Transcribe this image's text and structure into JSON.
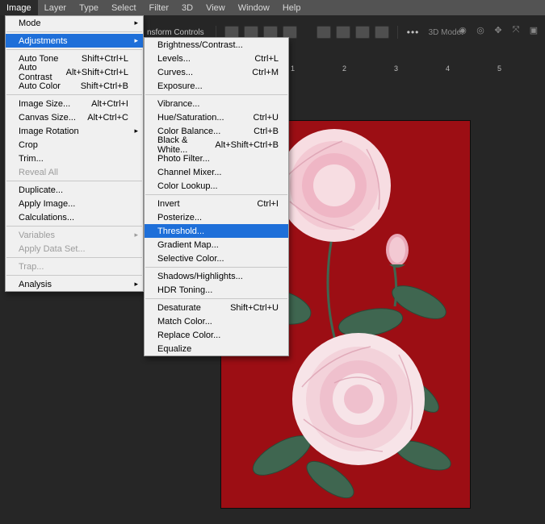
{
  "menubar": [
    "Image",
    "Layer",
    "Type",
    "Select",
    "Filter",
    "3D",
    "View",
    "Window",
    "Help"
  ],
  "menubar_active_index": 0,
  "options_label": "nsform Controls",
  "options_3dmode": "3D Mode:",
  "image_menu": [
    {
      "label": "Mode",
      "submenu": true,
      "shortcut": ""
    },
    {
      "sep": true
    },
    {
      "label": "Adjustments",
      "submenu": true,
      "highlight": true,
      "shortcut": ""
    },
    {
      "sep": true
    },
    {
      "label": "Auto Tone",
      "shortcut": "Shift+Ctrl+L"
    },
    {
      "label": "Auto Contrast",
      "shortcut": "Alt+Shift+Ctrl+L"
    },
    {
      "label": "Auto Color",
      "shortcut": "Shift+Ctrl+B"
    },
    {
      "sep": true
    },
    {
      "label": "Image Size...",
      "shortcut": "Alt+Ctrl+I"
    },
    {
      "label": "Canvas Size...",
      "shortcut": "Alt+Ctrl+C"
    },
    {
      "label": "Image Rotation",
      "submenu": true,
      "shortcut": ""
    },
    {
      "label": "Crop",
      "shortcut": ""
    },
    {
      "label": "Trim...",
      "shortcut": ""
    },
    {
      "label": "Reveal All",
      "shortcut": "",
      "disabled": true
    },
    {
      "sep": true
    },
    {
      "label": "Duplicate...",
      "shortcut": ""
    },
    {
      "label": "Apply Image...",
      "shortcut": ""
    },
    {
      "label": "Calculations...",
      "shortcut": ""
    },
    {
      "sep": true
    },
    {
      "label": "Variables",
      "submenu": true,
      "disabled": true,
      "shortcut": ""
    },
    {
      "label": "Apply Data Set...",
      "disabled": true,
      "shortcut": ""
    },
    {
      "sep": true
    },
    {
      "label": "Trap...",
      "disabled": true,
      "shortcut": ""
    },
    {
      "sep": true
    },
    {
      "label": "Analysis",
      "submenu": true,
      "shortcut": ""
    }
  ],
  "adjustments_menu": [
    {
      "label": "Brightness/Contrast...",
      "shortcut": ""
    },
    {
      "label": "Levels...",
      "shortcut": "Ctrl+L"
    },
    {
      "label": "Curves...",
      "shortcut": "Ctrl+M"
    },
    {
      "label": "Exposure...",
      "shortcut": ""
    },
    {
      "sep": true
    },
    {
      "label": "Vibrance...",
      "shortcut": ""
    },
    {
      "label": "Hue/Saturation...",
      "shortcut": "Ctrl+U"
    },
    {
      "label": "Color Balance...",
      "shortcut": "Ctrl+B"
    },
    {
      "label": "Black & White...",
      "shortcut": "Alt+Shift+Ctrl+B"
    },
    {
      "label": "Photo Filter...",
      "shortcut": ""
    },
    {
      "label": "Channel Mixer...",
      "shortcut": ""
    },
    {
      "label": "Color Lookup...",
      "shortcut": ""
    },
    {
      "sep": true
    },
    {
      "label": "Invert",
      "shortcut": "Ctrl+I"
    },
    {
      "label": "Posterize...",
      "shortcut": ""
    },
    {
      "label": "Threshold...",
      "highlight": true,
      "shortcut": ""
    },
    {
      "label": "Gradient Map...",
      "shortcut": ""
    },
    {
      "label": "Selective Color...",
      "shortcut": ""
    },
    {
      "sep": true
    },
    {
      "label": "Shadows/Highlights...",
      "shortcut": ""
    },
    {
      "label": "HDR Toning...",
      "shortcut": ""
    },
    {
      "sep": true
    },
    {
      "label": "Desaturate",
      "shortcut": "Shift+Ctrl+U"
    },
    {
      "label": "Match Color...",
      "shortcut": ""
    },
    {
      "label": "Replace Color...",
      "shortcut": ""
    },
    {
      "label": "Equalize",
      "shortcut": ""
    }
  ],
  "ruler_ticks": [
    "1",
    "2",
    "3",
    "4",
    "5"
  ]
}
